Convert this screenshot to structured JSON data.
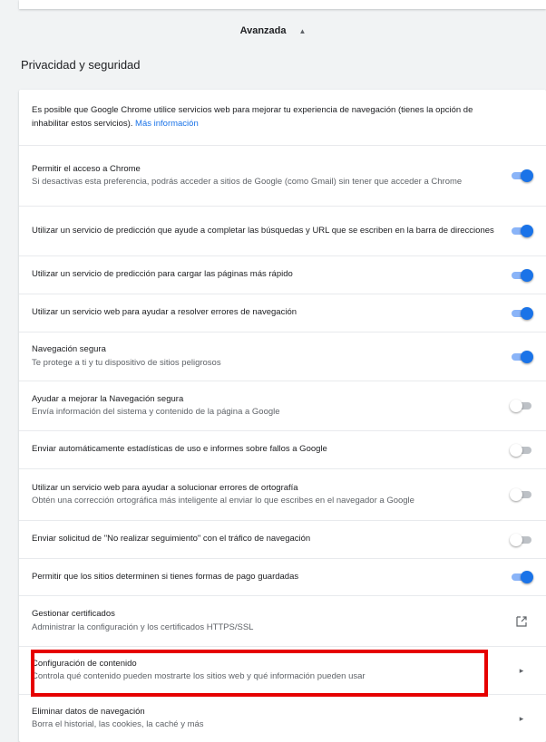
{
  "advanced": {
    "label": "Avanzada"
  },
  "section": {
    "title": "Privacidad y seguridad"
  },
  "rows": [
    {
      "title": "Es posible que Google Chrome utilice servicios web para mejorar tu experiencia de navegación (tienes la opción de inhabilitar estos servicios).",
      "link": "Más información"
    },
    {
      "title": "Permitir el acceso a Chrome",
      "sub": "Si desactivas esta preferencia, podrás acceder a sitios de Google (como Gmail) sin tener que acceder a Chrome",
      "state": "on"
    },
    {
      "title": "Utilizar un servicio de predicción que ayude a completar las búsquedas y URL que se escriben en la barra de direcciones",
      "state": "on"
    },
    {
      "title": "Utilizar un servicio de predicción para cargar las páginas más rápido",
      "state": "on"
    },
    {
      "title": "Utilizar un servicio web para ayudar a resolver errores de navegación",
      "state": "on"
    },
    {
      "title": "Navegación segura",
      "sub": "Te protege a ti y tu dispositivo de sitios peligrosos",
      "state": "on"
    },
    {
      "title": "Ayudar a mejorar la Navegación segura",
      "sub": "Envía información del sistema y contenido de la página a Google",
      "state": "off"
    },
    {
      "title": "Enviar automáticamente estadísticas de uso e informes sobre fallos a Google",
      "state": "off"
    },
    {
      "title": "Utilizar un servicio web para ayudar a solucionar errores de ortografía",
      "sub": "Obtén una corrección ortográfica más inteligente al enviar lo que escribes en el navegador a Google",
      "state": "off"
    },
    {
      "title": "Enviar solicitud de \"No realizar seguimiento\" con el tráfico de navegación",
      "state": "off"
    },
    {
      "title": "Permitir que los sitios determinen si tienes formas de pago guardadas",
      "state": "on"
    },
    {
      "title": "Gestionar certificados",
      "sub": "Administrar la configuración y los certificados HTTPS/SSL"
    },
    {
      "title": "Configuración de contenido",
      "sub": "Controla qué contenido pueden mostrarte los sitios web y qué información pueden usar"
    },
    {
      "title": "Eliminar datos de navegación",
      "sub": "Borra el historial, las cookies, la caché y más"
    }
  ],
  "colors": {
    "accent": "#1a73e8",
    "highlight": "#e60000"
  },
  "icons": {
    "collapse": "chevron-up-icon",
    "external": "open-in-new-icon",
    "arrow": "arrow-right-icon"
  }
}
